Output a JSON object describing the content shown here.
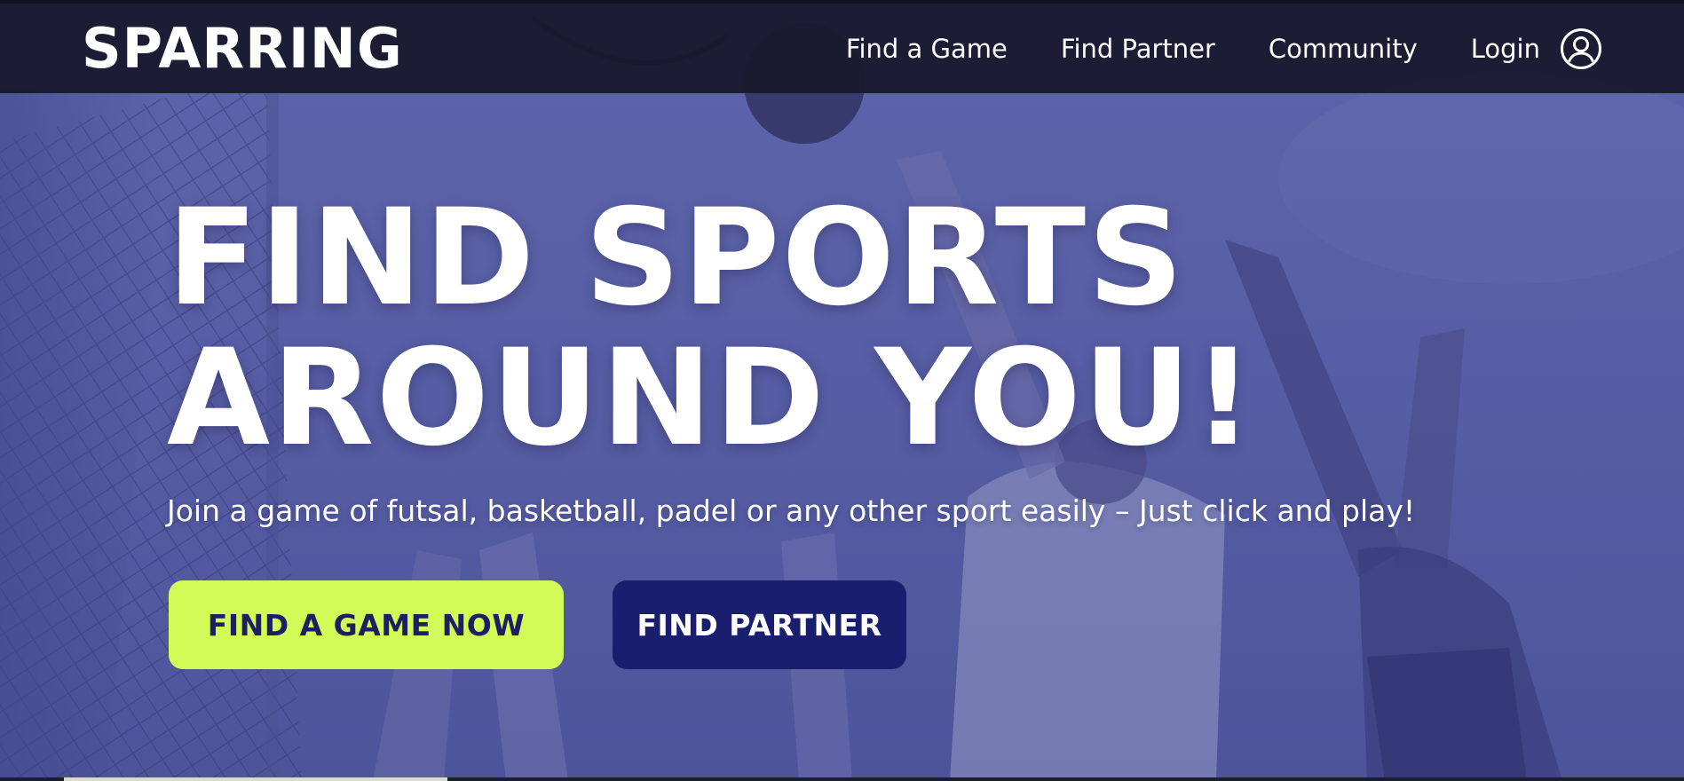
{
  "brand": {
    "logo_text": "SPARRING"
  },
  "nav": {
    "items": [
      {
        "label": "Find a Game"
      },
      {
        "label": "Find Partner"
      },
      {
        "label": "Community"
      },
      {
        "label": "Login"
      }
    ],
    "account_icon": "user-circle-icon"
  },
  "hero": {
    "headline_line1": "FIND SPORTS",
    "headline_line2": "AROUND YOU!",
    "subtitle": "Join a game of futsal, basketball, padel or any other sport easily – Just click and play!",
    "primary_button": "FIND A GAME NOW",
    "secondary_button": "FIND PARTNER"
  },
  "colors": {
    "navbar_bg": "#18182c",
    "hero_tint": "#5a60a6",
    "primary_button_bg": "#d3fb58",
    "primary_button_text": "#1b1f63",
    "secondary_button_bg": "#1a1e6e",
    "text": "#ffffff"
  }
}
